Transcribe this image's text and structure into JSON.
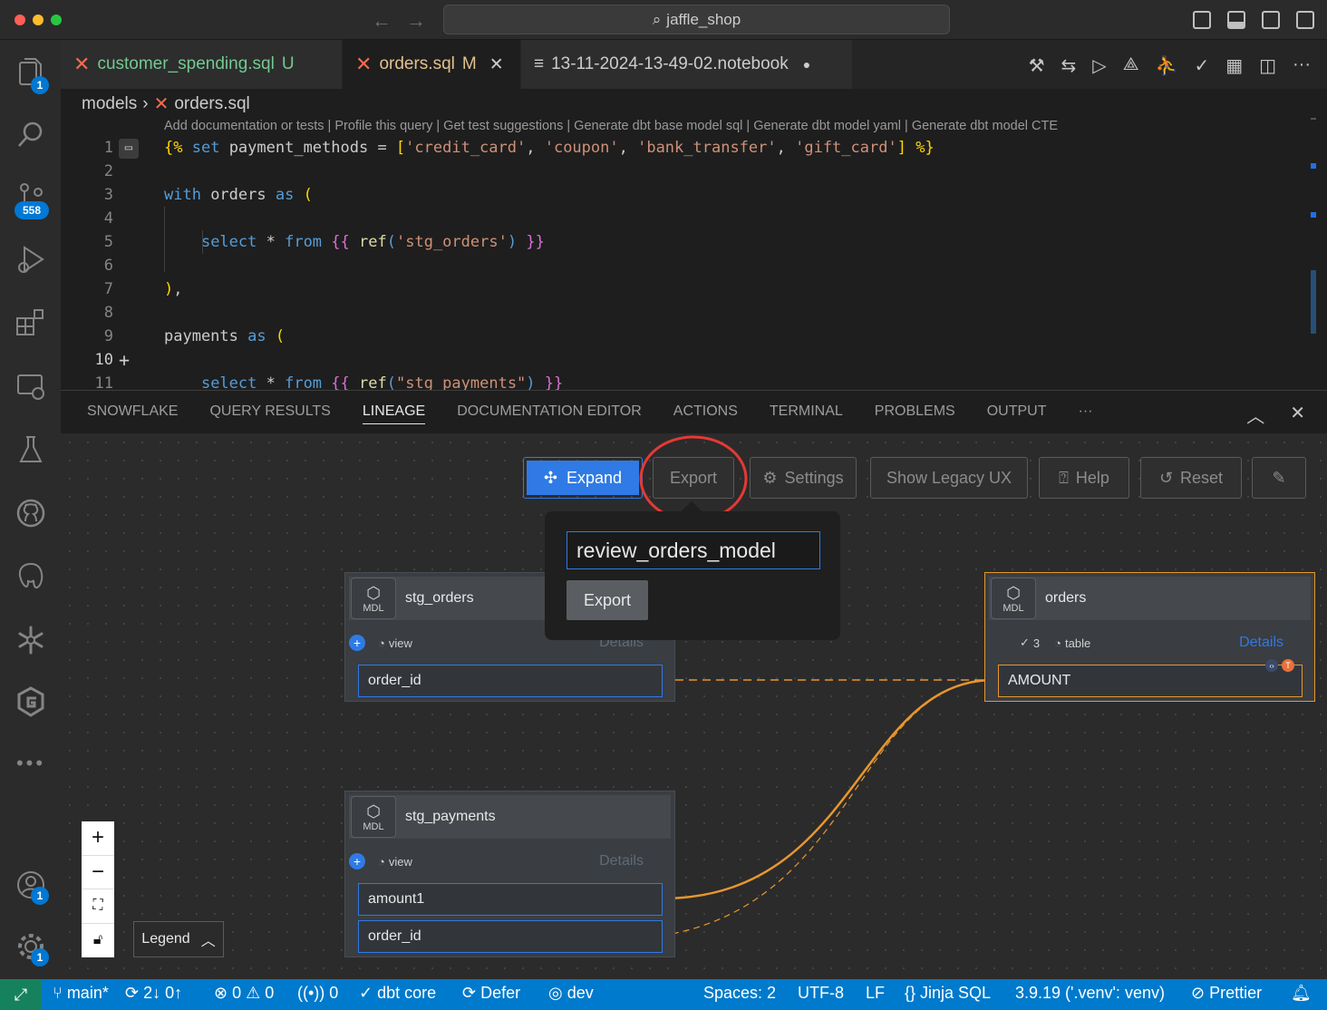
{
  "window": {
    "search_text": "jaffle_shop"
  },
  "activity_bar": {
    "explorer_badge": "1",
    "scm_badge": "558",
    "accounts_badge": "1",
    "settings_badge": "1"
  },
  "tabs": [
    {
      "name": "customer_spending.sql",
      "status": "U"
    },
    {
      "name": "orders.sql",
      "status": "M"
    },
    {
      "name": "13-11-2024-13-49-02.notebook"
    }
  ],
  "breadcrumb": {
    "folder": "models",
    "file": "orders.sql"
  },
  "codelens": "Add documentation or tests | Profile this query | Get test suggestions | Generate dbt base model sql | Generate dbt model yaml | Generate dbt model CTE",
  "editor": {
    "line_numbers": [
      "1",
      "2",
      "3",
      "4",
      "5",
      "6",
      "7",
      "8",
      "9",
      "10",
      "11"
    ]
  },
  "panel": {
    "tabs": [
      "SNOWFLAKE",
      "QUERY RESULTS",
      "LINEAGE",
      "DOCUMENTATION EDITOR",
      "ACTIONS",
      "TERMINAL",
      "PROBLEMS",
      "OUTPUT"
    ],
    "active_tab": "LINEAGE",
    "more": "···"
  },
  "lineage": {
    "toolbar": {
      "expand": "Expand",
      "export": "Export",
      "settings": "Settings",
      "legacy": "Show Legacy UX",
      "help": "Help",
      "reset": "Reset"
    },
    "export_popover": {
      "input_value": "review_orders_model",
      "button": "Export"
    },
    "nodes": {
      "stg_orders": {
        "badge": "MDL",
        "name": "stg_orders",
        "materialization": "view",
        "details": "Details",
        "columns": [
          "order_id"
        ]
      },
      "stg_payments": {
        "badge": "MDL",
        "name": "stg_payments",
        "materialization": "view",
        "details": "Details",
        "columns": [
          "amount1",
          "order_id"
        ]
      },
      "orders": {
        "badge": "MDL",
        "name": "orders",
        "tests": "3",
        "materialization": "table",
        "details": "Details",
        "columns": [
          "AMOUNT"
        ],
        "column_badge": "T"
      }
    },
    "legend": "Legend",
    "colors": {
      "accent": "#2f7ae5",
      "edge": "#e8962e",
      "highlight": "#e53935"
    }
  },
  "statusbar": {
    "branch": "main*",
    "sync": "2↓ 0↑",
    "errors": "0",
    "warnings": "0",
    "ports": "0",
    "dbt": "dbt core",
    "defer": "Defer",
    "target": "dev",
    "spaces": "Spaces: 2",
    "encoding": "UTF-8",
    "eol": "LF",
    "language": "Jinja SQL",
    "python": "3.9.19 ('.venv': venv)",
    "formatter": "Prettier"
  }
}
